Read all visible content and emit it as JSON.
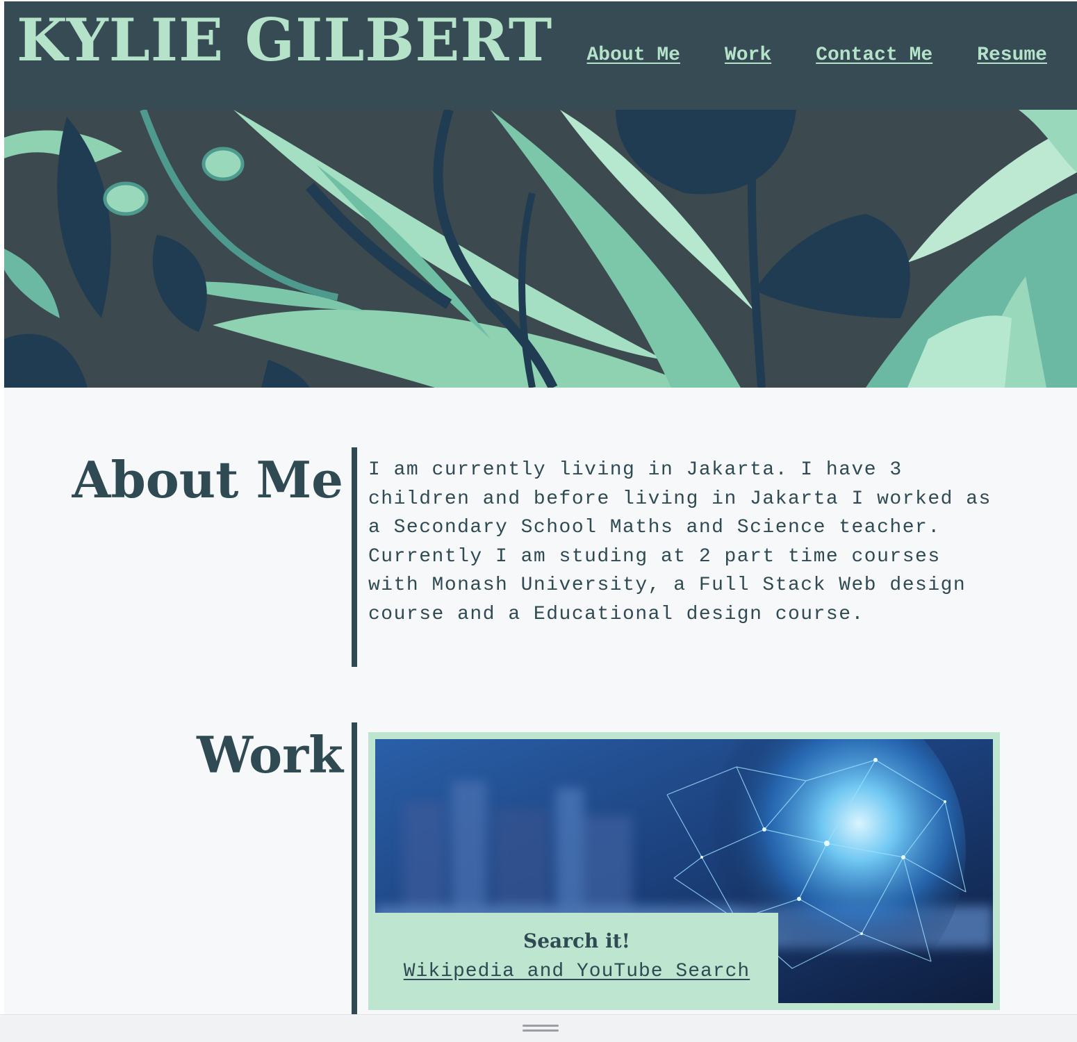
{
  "header": {
    "brand": "KYLIE GILBERT",
    "nav": [
      {
        "label": "About Me"
      },
      {
        "label": "Work"
      },
      {
        "label": "Contact Me"
      },
      {
        "label": "Resume"
      }
    ]
  },
  "hero": {
    "description_icon": "botanical-leaf-illustration"
  },
  "about": {
    "title": "About Me",
    "body": "I am currently living in Jakarta. I have 3 children and before living in Jakarta I worked as a Secondary School Maths and Science teacher. Currently I am studing at 2 part time courses with Monash University, a Full Stack Web design course and a Educational design course."
  },
  "work": {
    "title": "Work",
    "project": {
      "title": "Search it!",
      "link_label": "Wikipedia and YouTube Search"
    }
  },
  "colors": {
    "header_bg": "#374b55",
    "accent_mint": "#b4e3c9",
    "text_dark": "#2f4a52",
    "page_bg": "#f7f8fa"
  }
}
